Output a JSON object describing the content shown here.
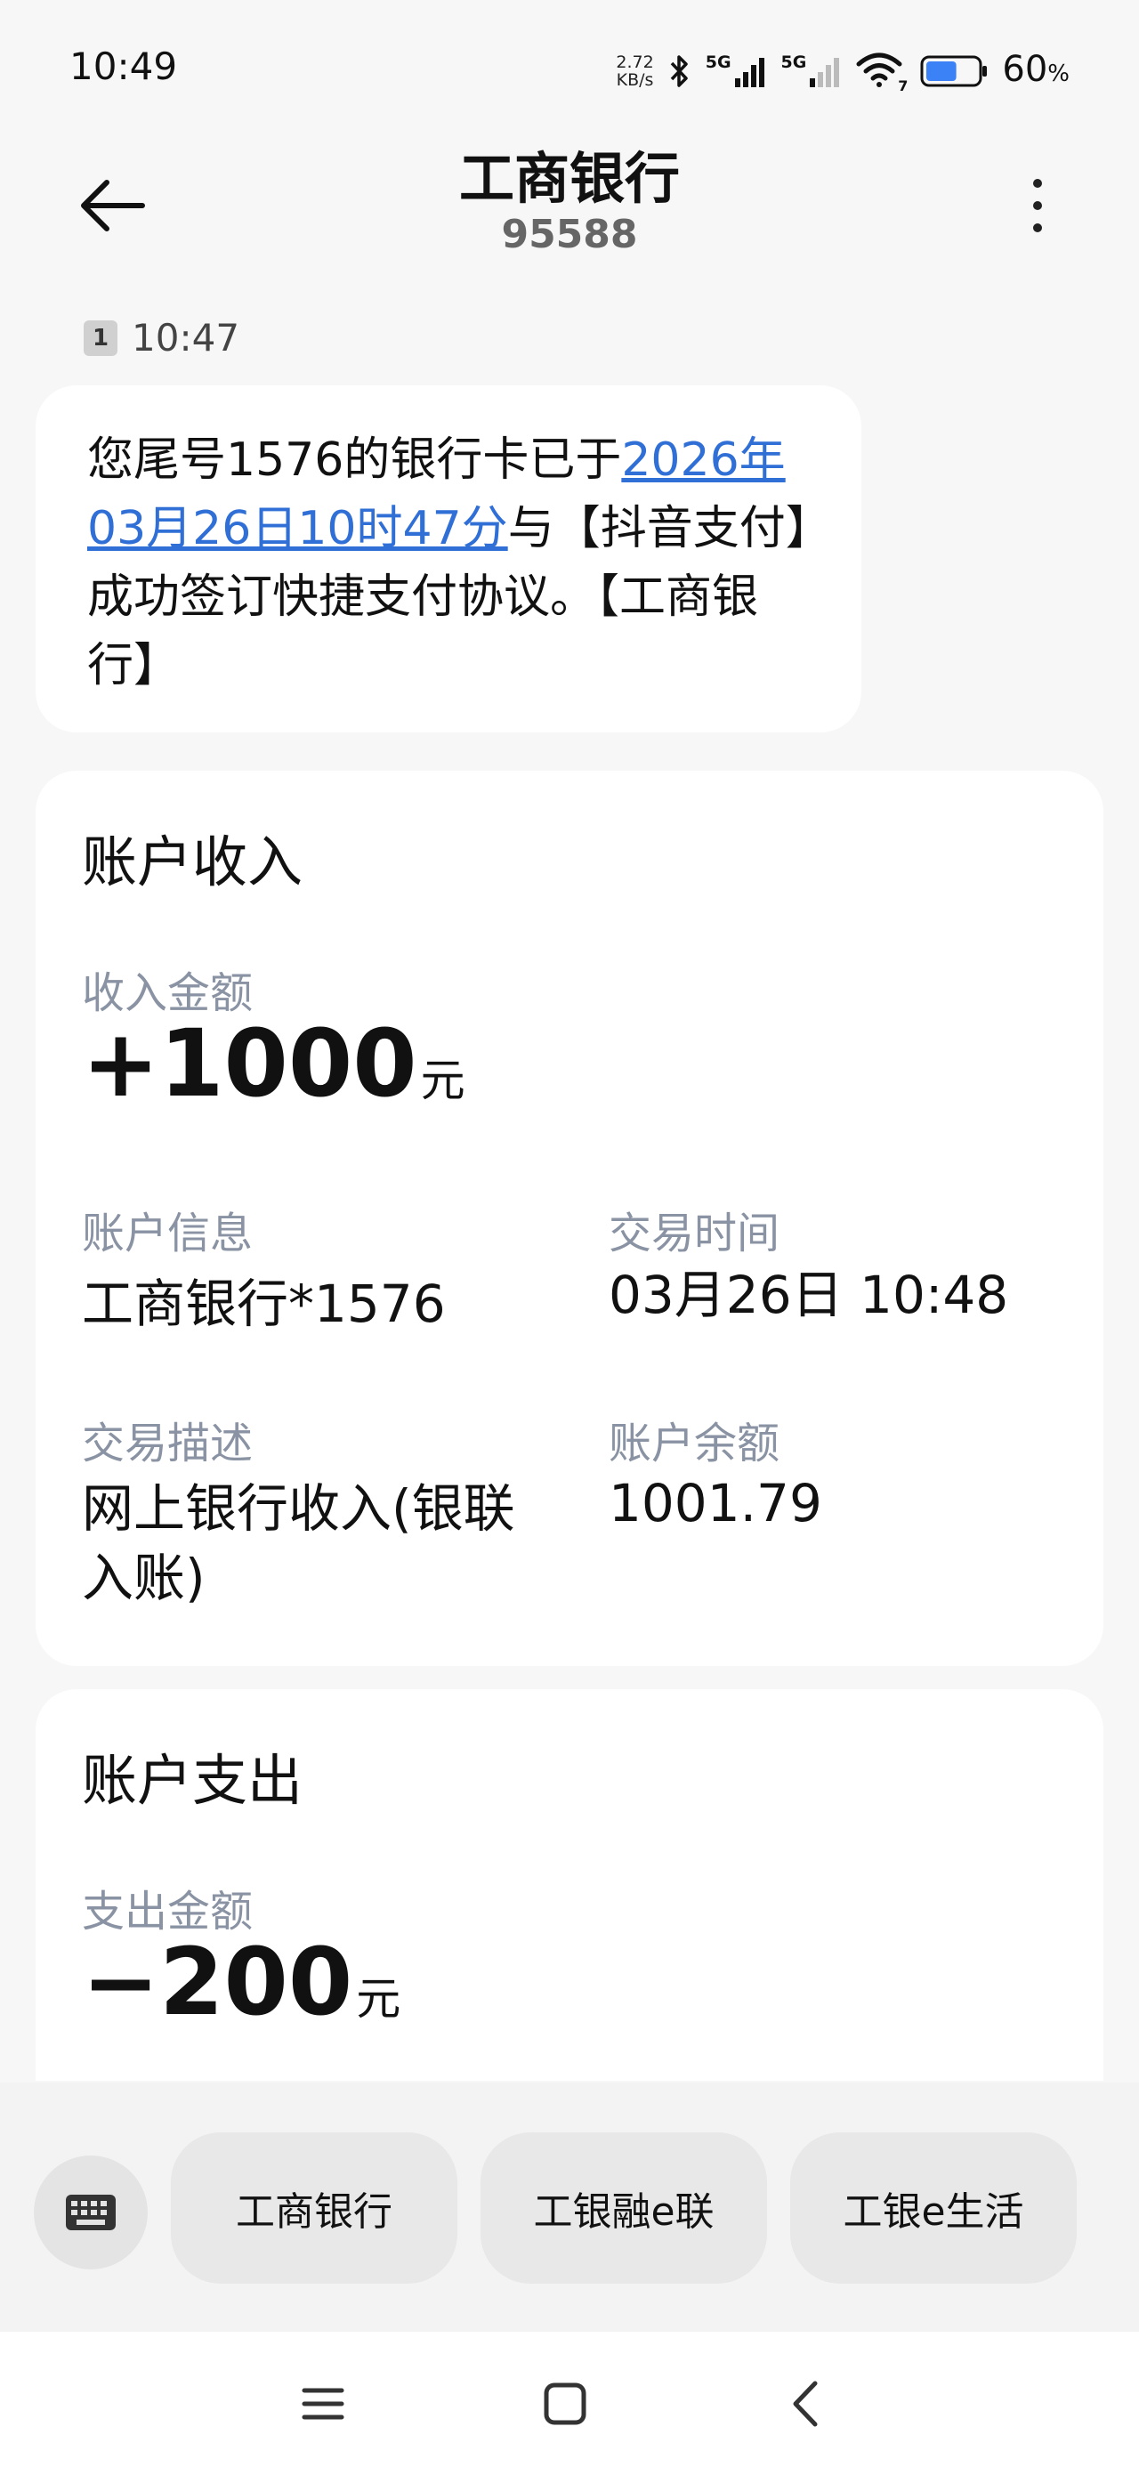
{
  "status": {
    "time": "10:49",
    "net_speed_value": "2.72",
    "net_speed_unit": "KB/s",
    "sig1_label": "5G",
    "sig2_label": "5G",
    "wifi_badge": "7",
    "battery_pct": "60",
    "battery_unit": "%",
    "battery_level": 0.6
  },
  "header": {
    "title": "工商银行",
    "number": "95588"
  },
  "message": {
    "sim": "1",
    "time": "10:47",
    "text_before": "您尾号1576的银行卡已于",
    "link_text": "2026年03月26日10时47分",
    "text_after": "与【抖音支付】成功签订快捷支付协议。【工商银行】"
  },
  "income_card": {
    "title": "账户收入",
    "amount_label": "收入金额",
    "amount": "+1000",
    "unit": "元",
    "account_label": "账户信息",
    "account_value": "工商银行*1576",
    "time_label": "交易时间",
    "time_value": "03月26日 10:48",
    "desc_label": "交易描述",
    "desc_value": "网上银行收入(银联入账)",
    "balance_label": "账户余额",
    "balance_value": "1001.79"
  },
  "expense_card": {
    "title": "账户支出",
    "amount_label": "支出金额",
    "amount": "−200",
    "unit": "元"
  },
  "quick_replies": {
    "btn1": "工商银行",
    "btn2": "工银融e联",
    "btn3": "工银e生活"
  },
  "colors": {
    "link": "#2f6fd6",
    "label": "#8a93a3",
    "battery": "#3b82f6"
  }
}
